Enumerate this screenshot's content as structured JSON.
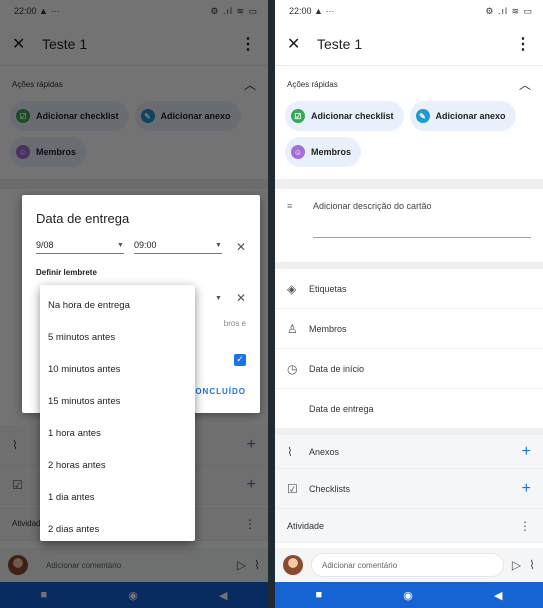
{
  "status": {
    "time": "22:00",
    "time_suffix": "▲ ···",
    "icons": "⚙ .ıl ≋ ▭"
  },
  "card": {
    "title": "Teste 1"
  },
  "quick_actions": {
    "label": "Ações rápidas",
    "checklist": "Adicionar checklist",
    "attachment": "Adicionar anexo",
    "members": "Membros"
  },
  "detail": {
    "description_placeholder": "Adicionar descrição do cartão",
    "labels": "Etiquetas",
    "members": "Membros",
    "start_date": "Data de início",
    "due_date": "Data de entrega",
    "attachments": "Anexos",
    "checklists": "Checklists",
    "activity": "Atividade"
  },
  "comment": {
    "placeholder": "Adicionar comentário"
  },
  "dialog": {
    "title": "Data de entrega",
    "date_value": "9/08",
    "time_value": "09:00",
    "reminder_label": "Definir lembrete",
    "partial_text": "bros e",
    "done_label": "ONCLUÍDO"
  },
  "reminder_options": [
    "Na hora de entrega",
    "5 minutos antes",
    "10 minutos antes",
    "15 minutos antes",
    "1 hora antes",
    "2 horas antes",
    "1 dia antes",
    "2 dias antes"
  ],
  "colors": {
    "accent": "#1a73e8",
    "chip_bg": "#e8f1fb",
    "navbar": "#1663d4",
    "checklist_icon": "#34a853",
    "attachment_icon": "#1a9bd8",
    "members_icon": "#a66cd9"
  }
}
